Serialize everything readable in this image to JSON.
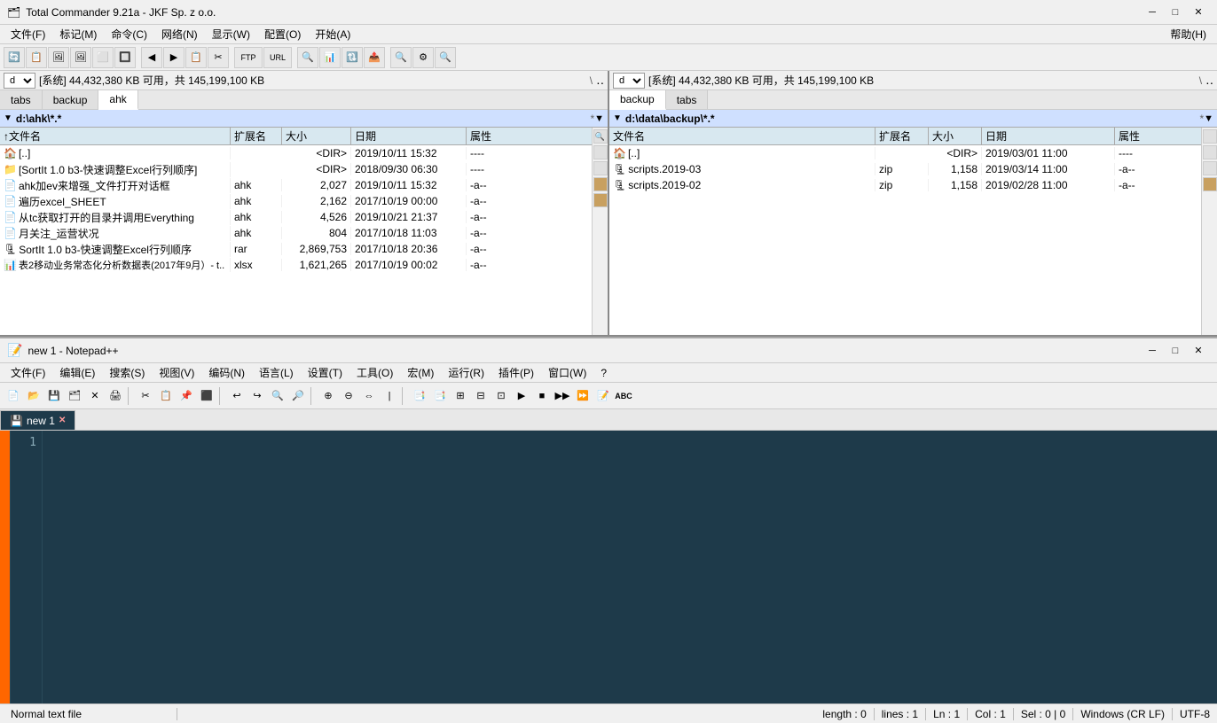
{
  "tc_titlebar": {
    "icon": "🗂",
    "title": "Total Commander 9.21a - JKF Sp. z o.o.",
    "min_btn": "─",
    "max_btn": "□",
    "close_btn": "✕"
  },
  "tc_menu": {
    "items": [
      "文件(F)",
      "标记(M)",
      "命令(C)",
      "网络(N)",
      "显示(W)",
      "配置(O)",
      "开始(A)",
      "帮助(H)"
    ]
  },
  "left_panel": {
    "drive": "d",
    "drive_info": "[系统]  44,432,380 KB 可用，共 145,199,100 KB",
    "sep": "\\",
    "tabs": [
      "tabs",
      "backup",
      "ahk"
    ],
    "active_tab": "ahk",
    "path": "d:\\ahk\\*.*",
    "headers": {
      "name": "文件名",
      "name_sort": "↑",
      "ext": "扩展名",
      "size": "大小",
      "date": "日期",
      "attr": "属性"
    },
    "files": [
      {
        "icon": "🏠",
        "name": "[..]",
        "ext": "",
        "size": "<DIR>",
        "date": "2019/10/11 15:32",
        "attr": "----",
        "is_dir": true
      },
      {
        "icon": "📁",
        "name": "[SortIt 1.0 b3-快速调整Excel行列顺序]",
        "ext": "",
        "size": "<DIR>",
        "date": "2018/09/30 06:30",
        "attr": "----",
        "is_dir": true
      },
      {
        "icon": "📄",
        "name": "ahk加ev来增强_文件打开对话框",
        "ext": "ahk",
        "size": "2,027",
        "date": "2019/10/11 15:32",
        "attr": "-a--",
        "is_dir": false
      },
      {
        "icon": "📄",
        "name": "遍历excel_SHEET",
        "ext": "ahk",
        "size": "2,162",
        "date": "2017/10/19 00:00",
        "attr": "-a--",
        "is_dir": false
      },
      {
        "icon": "📄",
        "name": "从tc获取打开的目录并调用Everything",
        "ext": "ahk",
        "size": "4,526",
        "date": "2019/10/21 21:37",
        "attr": "-a--",
        "is_dir": false
      },
      {
        "icon": "📄",
        "name": "月关注_运营状况",
        "ext": "ahk",
        "size": "804",
        "date": "2017/10/18 11:03",
        "attr": "-a--",
        "is_dir": false
      },
      {
        "icon": "🗜",
        "name": "SortIt 1.0 b3-快速调整Excel行列顺序",
        "ext": "rar",
        "size": "2,869,753",
        "date": "2017/10/18 20:36",
        "attr": "-a--",
        "is_dir": false
      },
      {
        "icon": "📊",
        "name": "表2移动业务常态化分析数据表(2017年9月）- t..",
        "ext": "xlsx",
        "size": "1,621,265",
        "date": "2017/10/19 00:02",
        "attr": "-a--",
        "is_dir": false
      }
    ]
  },
  "right_panel": {
    "drive": "d",
    "drive_info": "[系统]  44,432,380 KB 可用，共 145,199,100 KB",
    "sep": "\\",
    "tabs": [
      "backup",
      "tabs"
    ],
    "active_tab": "backup",
    "path": "d:\\data\\backup\\*.*",
    "headers": {
      "name": "文件名",
      "ext": "扩展名",
      "size": "大小",
      "date": "日期",
      "attr": "属性"
    },
    "files": [
      {
        "icon": "🏠",
        "name": "[..]",
        "ext": "",
        "size": "<DIR>",
        "date": "2019/03/01 11:00",
        "attr": "----",
        "is_dir": true
      },
      {
        "icon": "🗜",
        "name": "scripts.2019-03",
        "ext": "zip",
        "size": "1,158",
        "date": "2019/03/14 11:00",
        "attr": "-a--",
        "is_dir": false
      },
      {
        "icon": "🗜",
        "name": "scripts.2019-02",
        "ext": "zip",
        "size": "1,158",
        "date": "2019/02/28 11:00",
        "attr": "-a--",
        "is_dir": false
      }
    ]
  },
  "npp_titlebar": {
    "icon": "📝",
    "title": "new 1 - Notepad++",
    "min_btn": "─",
    "max_btn": "□",
    "close_btn": "✕"
  },
  "npp_menu": {
    "items": [
      "文件(F)",
      "编辑(E)",
      "搜索(S)",
      "视图(V)",
      "编码(N)",
      "语言(L)",
      "设置(T)",
      "工具(O)",
      "宏(M)",
      "运行(R)",
      "插件(P)",
      "窗口(W)",
      "?"
    ]
  },
  "npp_tabs": [
    {
      "label": "new 1",
      "active": true,
      "modified": false
    }
  ],
  "editor": {
    "line_numbers": [
      "1"
    ],
    "content": ""
  },
  "statusbar": {
    "file_type": "Normal text file",
    "length": "length : 0",
    "lines": "lines : 1",
    "ln": "Ln : 1",
    "col": "Col : 1",
    "sel": "Sel : 0 | 0",
    "encoding": "Windows (CR LF)",
    "charset": "UTF-8"
  }
}
